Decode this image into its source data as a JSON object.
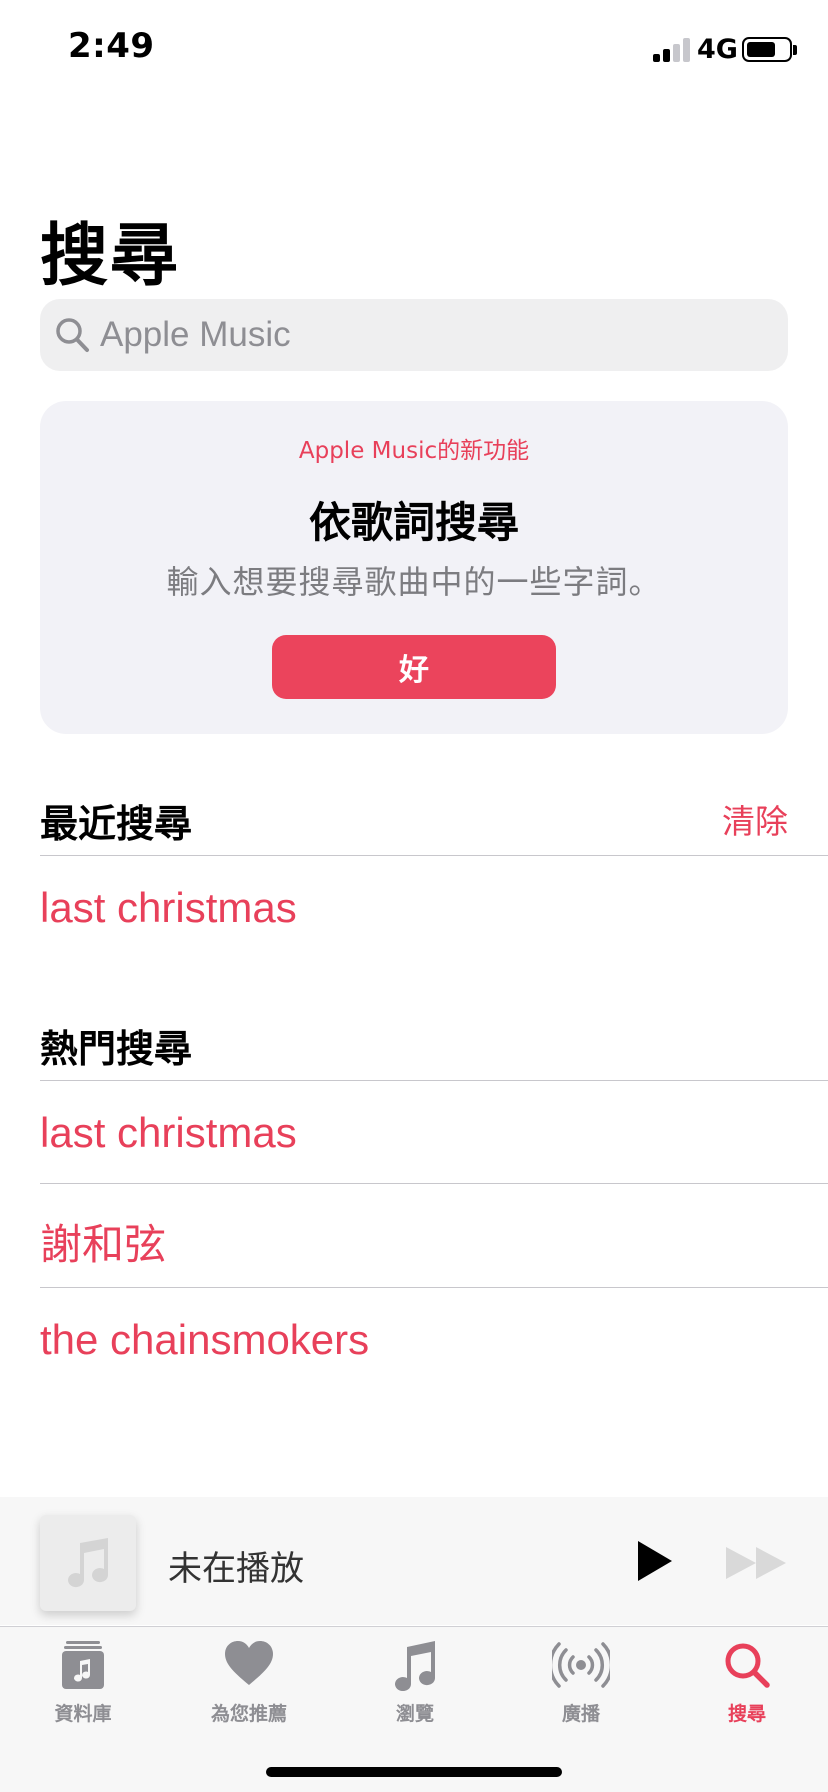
{
  "status_bar": {
    "time": "2:49",
    "network": "4G",
    "signal_bars_active": 2,
    "signal_bars_total": 4,
    "battery_level": 0.65
  },
  "page": {
    "title": "搜尋"
  },
  "search": {
    "placeholder": "Apple Music",
    "icon": "magnifying-glass"
  },
  "feature_card": {
    "eyebrow": "Apple Music的新功能",
    "title": "依歌詞搜尋",
    "description": "輸入想要搜尋歌曲中的一些字詞。",
    "button_label": "好"
  },
  "recent_searches": {
    "header": "最近搜尋",
    "clear_label": "清除",
    "items": [
      "last christmas"
    ]
  },
  "trending_searches": {
    "header": "熱門搜尋",
    "items": [
      "last christmas",
      "謝和弦",
      "the chainsmokers"
    ]
  },
  "mini_player": {
    "status": "未在播放",
    "artwork_icon": "music-note",
    "play_icon": "play",
    "forward_icon": "fast-forward"
  },
  "tab_bar": {
    "tabs": [
      {
        "label": "資料庫",
        "icon": "library",
        "active": false
      },
      {
        "label": "為您推薦",
        "icon": "heart",
        "active": false
      },
      {
        "label": "瀏覽",
        "icon": "music-note",
        "active": false
      },
      {
        "label": "廣播",
        "icon": "radio-broadcast",
        "active": false
      },
      {
        "label": "搜尋",
        "icon": "magnifying-glass",
        "active": true
      }
    ]
  },
  "colors": {
    "accent": "#e8405a",
    "button": "#eb445c",
    "inactive": "#8e8e93",
    "card_bg": "#f2f2f7"
  }
}
